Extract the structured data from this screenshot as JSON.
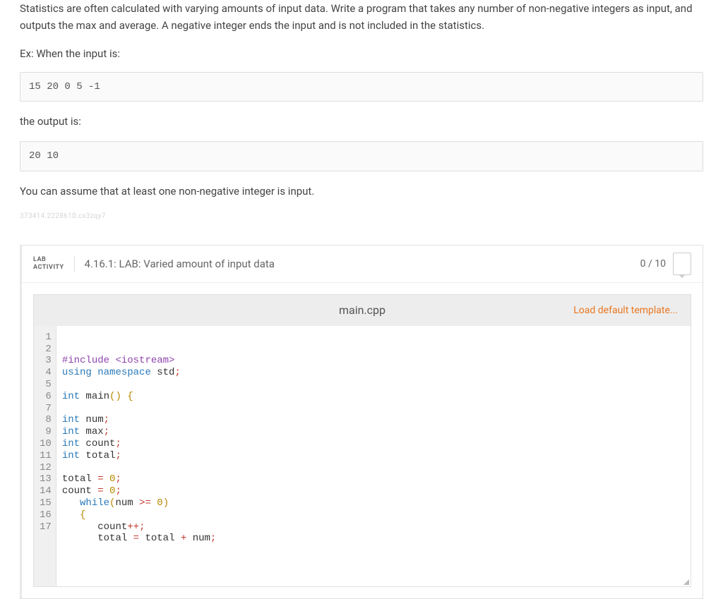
{
  "problem": {
    "description": "Statistics are often calculated with varying amounts of input data. Write a program that takes any number of non-negative integers as input, and outputs the max and average. A negative integer ends the input and is not included in the statistics.",
    "example_label": "Ex: When the input is:",
    "example_input": "15 20 0 5 -1",
    "output_label": "the output is:",
    "example_output": "20 10",
    "assumption": "You can assume that at least one non-negative integer is input.",
    "watermark": "373414.2228610.cx3zqy7"
  },
  "lab": {
    "badge_line1": "LAB",
    "badge_line2": "ACTIVITY",
    "title": "4.16.1: LAB: Varied amount of input data",
    "score": "0 / 10"
  },
  "editor": {
    "filename": "main.cpp",
    "load_template": "Load default template...",
    "line_count": 17,
    "code_lines": [
      {
        "n": 1,
        "tokens": [
          {
            "t": "#include ",
            "c": "kw-preproc"
          },
          {
            "t": "<iostream>",
            "c": "kw-preproc"
          }
        ]
      },
      {
        "n": 2,
        "tokens": [
          {
            "t": "using ",
            "c": "kw-blue"
          },
          {
            "t": "namespace ",
            "c": "kw-blue"
          },
          {
            "t": "std",
            "c": "ident"
          },
          {
            "t": ";",
            "c": "punct"
          }
        ]
      },
      {
        "n": 3,
        "tokens": []
      },
      {
        "n": 4,
        "tokens": [
          {
            "t": "int ",
            "c": "kw-type"
          },
          {
            "t": "main",
            "c": "ident"
          },
          {
            "t": "(",
            "c": "paren"
          },
          {
            "t": ") ",
            "c": "paren"
          },
          {
            "t": "{",
            "c": "brace"
          }
        ]
      },
      {
        "n": 5,
        "tokens": []
      },
      {
        "n": 6,
        "tokens": [
          {
            "t": "int ",
            "c": "kw-type"
          },
          {
            "t": "num",
            "c": "ident"
          },
          {
            "t": ";",
            "c": "punct"
          }
        ]
      },
      {
        "n": 7,
        "tokens": [
          {
            "t": "int ",
            "c": "kw-type"
          },
          {
            "t": "max",
            "c": "ident"
          },
          {
            "t": ";",
            "c": "punct"
          }
        ]
      },
      {
        "n": 8,
        "tokens": [
          {
            "t": "int ",
            "c": "kw-type"
          },
          {
            "t": "count",
            "c": "ident"
          },
          {
            "t": ";",
            "c": "punct"
          }
        ]
      },
      {
        "n": 9,
        "tokens": [
          {
            "t": "int ",
            "c": "kw-type"
          },
          {
            "t": "total",
            "c": "ident"
          },
          {
            "t": ";",
            "c": "punct"
          }
        ]
      },
      {
        "n": 10,
        "tokens": []
      },
      {
        "n": 11,
        "tokens": [
          {
            "t": "total ",
            "c": "ident"
          },
          {
            "t": "= ",
            "c": "op"
          },
          {
            "t": "0",
            "c": "num"
          },
          {
            "t": ";",
            "c": "punct"
          }
        ]
      },
      {
        "n": 12,
        "tokens": [
          {
            "t": "count ",
            "c": "ident"
          },
          {
            "t": "= ",
            "c": "op"
          },
          {
            "t": "0",
            "c": "num"
          },
          {
            "t": ";",
            "c": "punct"
          }
        ]
      },
      {
        "n": 13,
        "tokens": [
          {
            "t": "   ",
            "c": ""
          },
          {
            "t": "while",
            "c": "kw-blue"
          },
          {
            "t": "(",
            "c": "paren"
          },
          {
            "t": "num ",
            "c": "ident"
          },
          {
            "t": ">= ",
            "c": "op"
          },
          {
            "t": "0",
            "c": "num"
          },
          {
            "t": ")",
            "c": "paren"
          }
        ]
      },
      {
        "n": 14,
        "tokens": [
          {
            "t": "   ",
            "c": ""
          },
          {
            "t": "{",
            "c": "brace"
          }
        ]
      },
      {
        "n": 15,
        "tokens": [
          {
            "t": "      ",
            "c": ""
          },
          {
            "t": "count",
            "c": "ident"
          },
          {
            "t": "++",
            "c": "op"
          },
          {
            "t": ";",
            "c": "punct"
          }
        ]
      },
      {
        "n": 16,
        "tokens": [
          {
            "t": "      ",
            "c": ""
          },
          {
            "t": "total ",
            "c": "ident"
          },
          {
            "t": "= ",
            "c": "op"
          },
          {
            "t": "total ",
            "c": "ident"
          },
          {
            "t": "+ ",
            "c": "op"
          },
          {
            "t": "num",
            "c": "ident"
          },
          {
            "t": ";",
            "c": "punct"
          }
        ]
      },
      {
        "n": 17,
        "tokens": []
      }
    ]
  }
}
